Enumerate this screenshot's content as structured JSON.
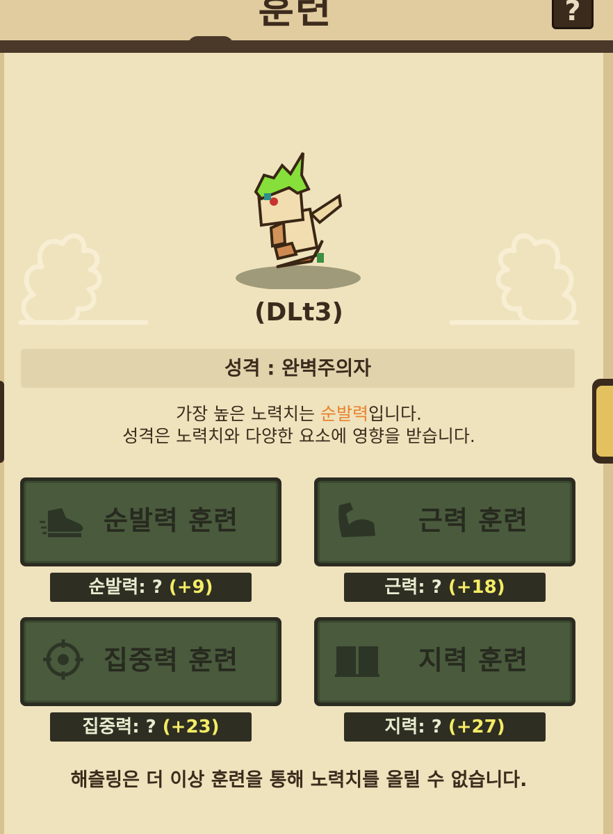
{
  "header": {
    "title": "훈련",
    "help_label": "?"
  },
  "character": {
    "name": "(DLt3)"
  },
  "personality": {
    "label": "성격 : 완벽주의자"
  },
  "description": {
    "line1_prefix": "가장 높은 노력치는 ",
    "line1_highlight": "순발력",
    "line1_suffix": "입니다.",
    "line2": "성격은 노력치와 다양한 요소에 영향을 받습니다.",
    "highlight_color": "#e8822e"
  },
  "training": [
    {
      "label": "순발력 훈련",
      "icon": "shoe-icon",
      "stat_name": "순발력: ? ",
      "stat_value": "(+9)"
    },
    {
      "label": "근력 훈련",
      "icon": "arm-muscle-icon",
      "stat_name": "근력: ? ",
      "stat_value": "(+18)"
    },
    {
      "label": "집중력 훈련",
      "icon": "crosshair-icon",
      "stat_name": "집중력: ? ",
      "stat_value": "(+23)"
    },
    {
      "label": "지력 훈련",
      "icon": "book-icon",
      "stat_name": "지력: ? ",
      "stat_value": "(+27)"
    }
  ],
  "footer": {
    "message": "해츨링은 더 이상 훈련을 통해 노력치를 올릴 수 없습니다."
  },
  "colors": {
    "background": "#efe3bd",
    "button_fill": "#4a5a3d",
    "stat_value": "#f4ec66"
  }
}
